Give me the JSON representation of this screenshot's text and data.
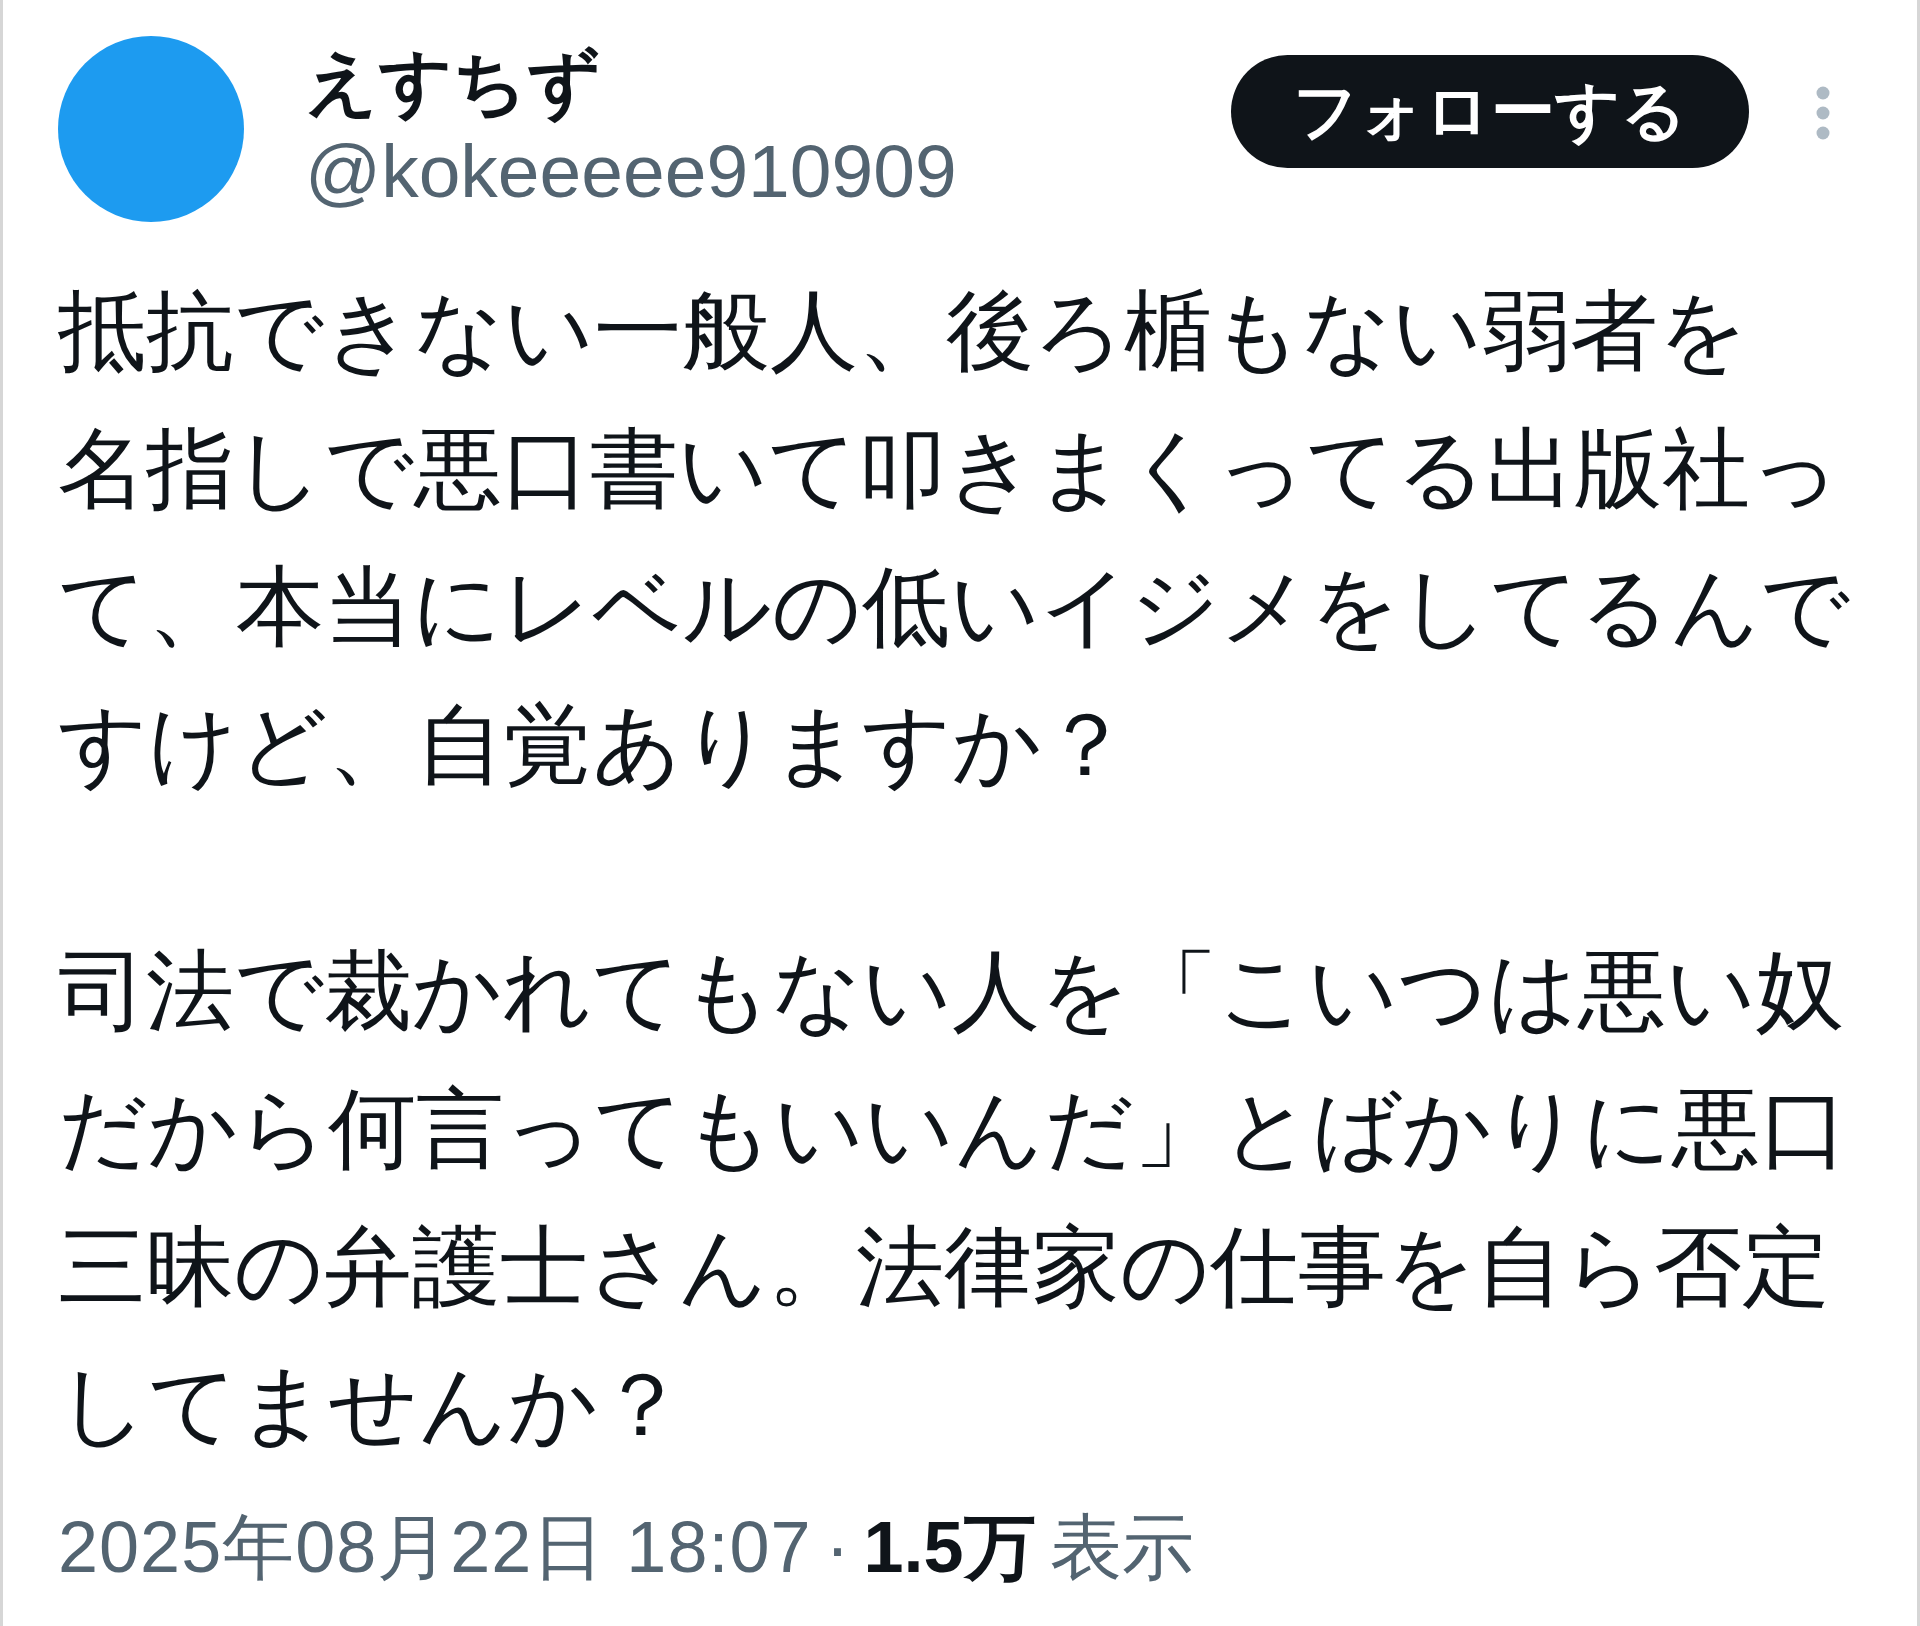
{
  "author": {
    "display_name": "えすちず",
    "handle": "@kokeeeee910909"
  },
  "follow_button": {
    "label": "フォローする"
  },
  "tweet": {
    "paragraphs": [
      [
        "抵抗できない一般人、後ろ楯もない弱者を",
        "名指しで悪口書いて叩きまくってる出版社って、本当にレベルの低いイジメをしてるんですけど、自覚ありますか？"
      ],
      [
        "司法で裁かれてもない人を「こいつは悪い奴だから何言ってもいいんだ」とばかりに悪口三昧の弁護士さん。法律家の仕事を自ら否定してませんか？"
      ]
    ]
  },
  "meta": {
    "timestamp": "2025年08月22日 18:07",
    "separator": "·",
    "views_count": "1.5万",
    "views_label": "表示"
  }
}
